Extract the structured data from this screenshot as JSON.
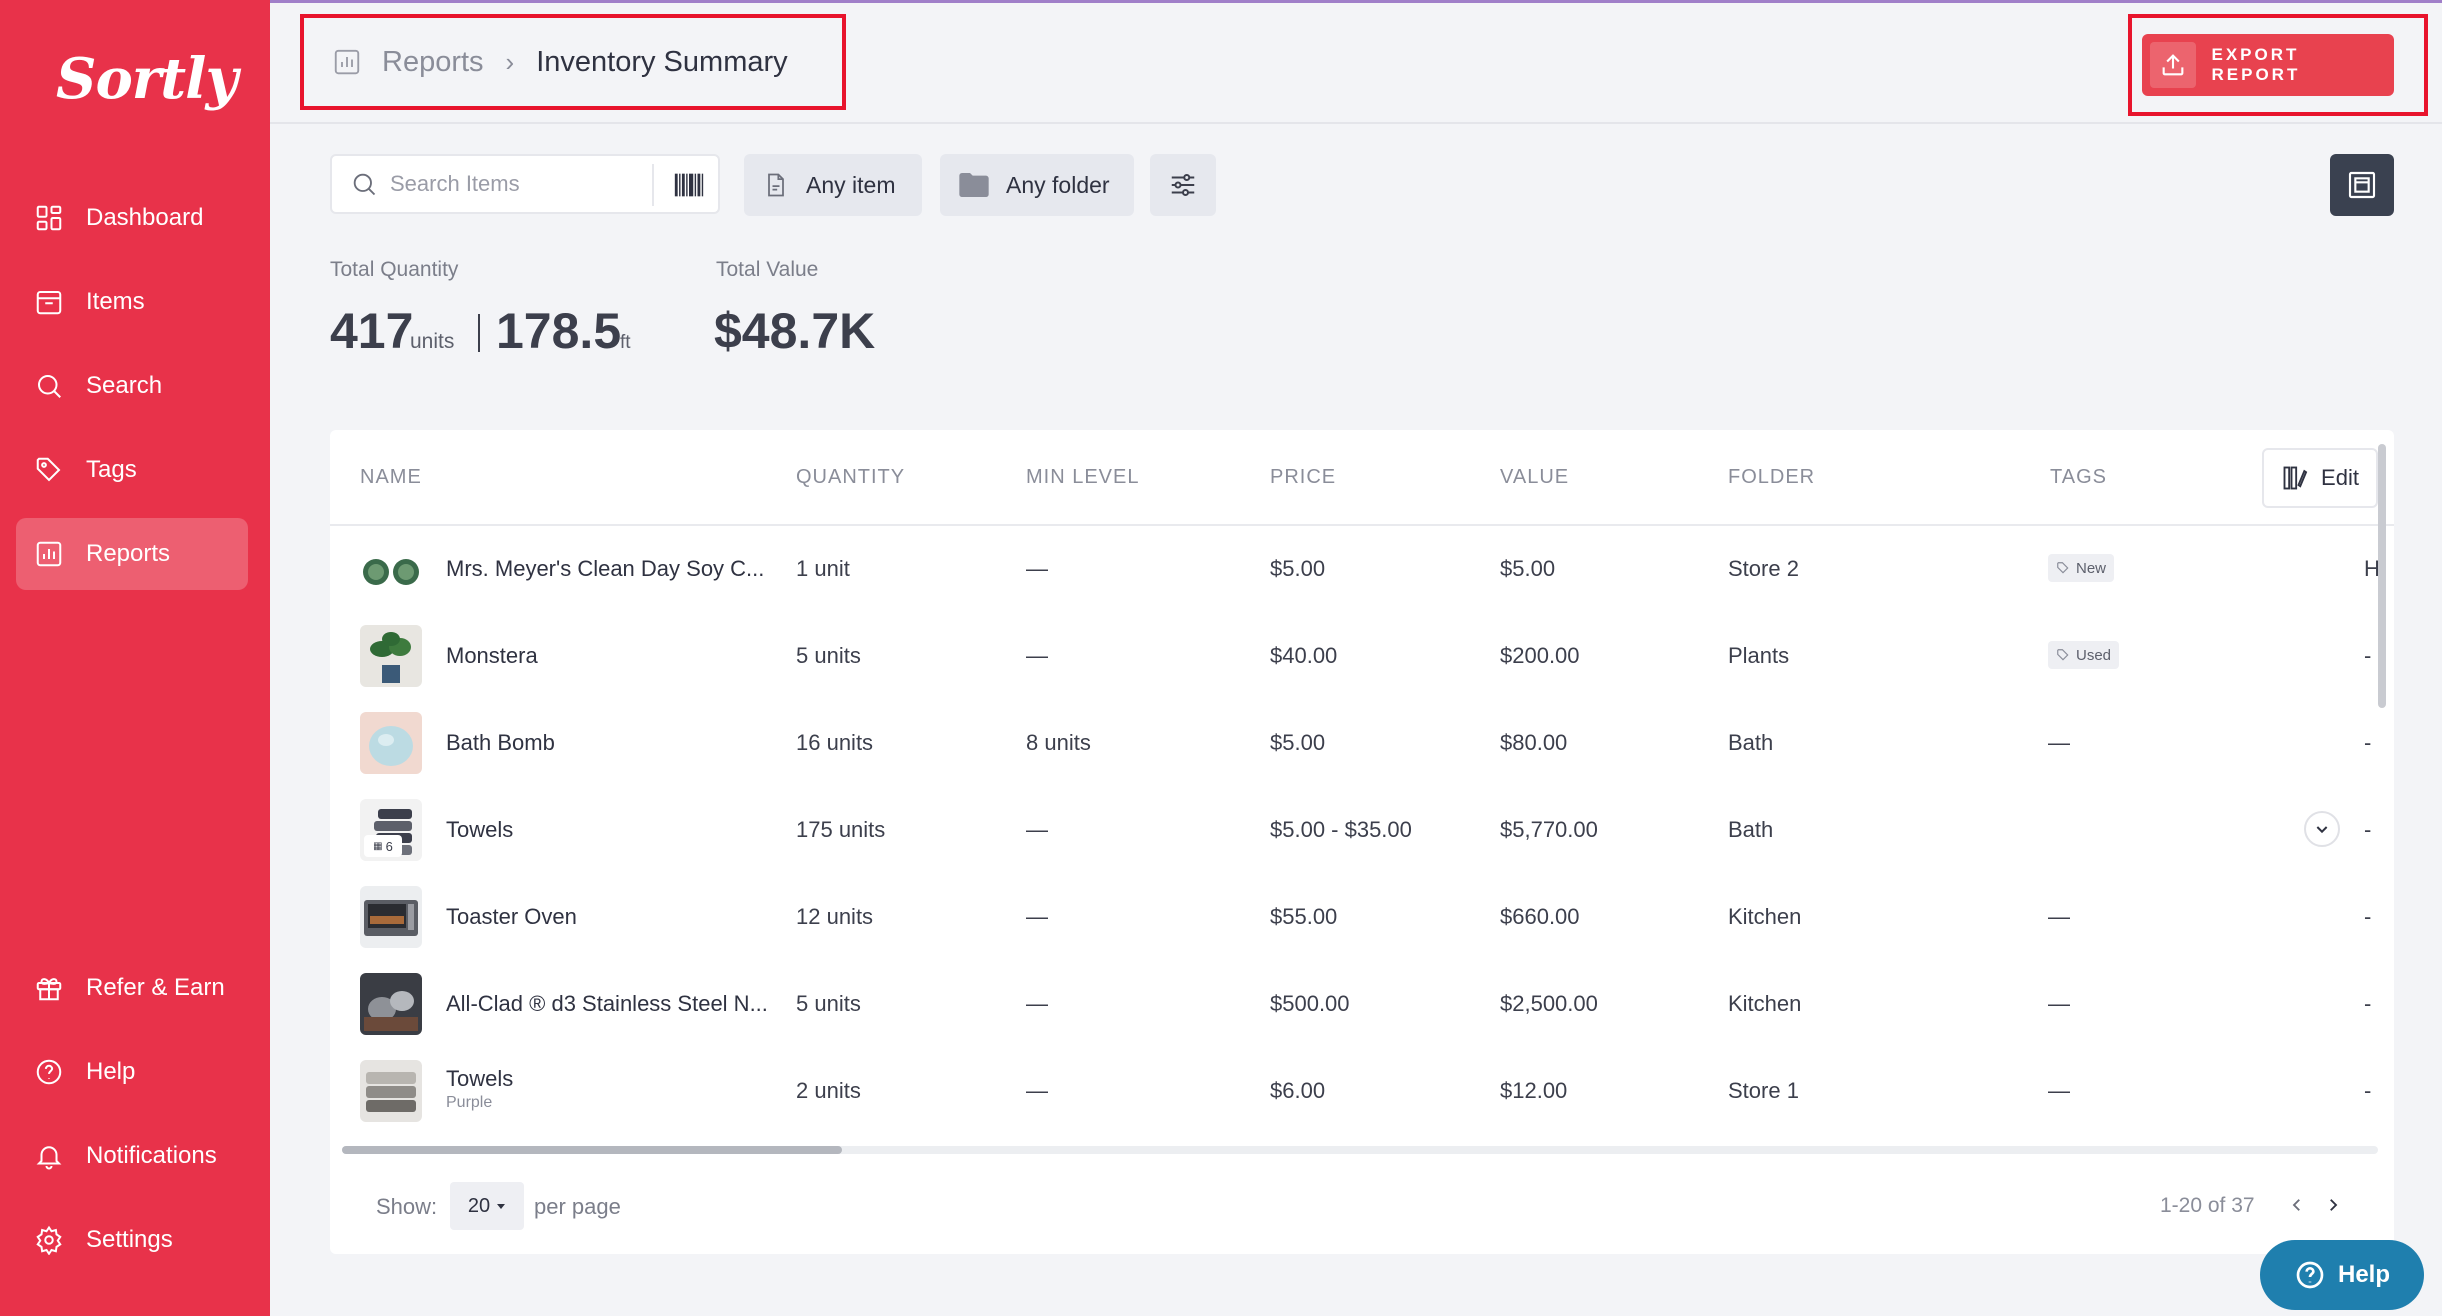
{
  "colors": {
    "sidebar": "#e8324a",
    "accent": "#e8424f",
    "highlight_box": "#e8142d",
    "help_fab": "#1f7fae"
  },
  "sidebar": {
    "logo": "Sortly",
    "items": [
      {
        "label": "Dashboard",
        "icon": "dashboard-icon"
      },
      {
        "label": "Items",
        "icon": "items-icon"
      },
      {
        "label": "Search",
        "icon": "search-icon"
      },
      {
        "label": "Tags",
        "icon": "tag-icon"
      },
      {
        "label": "Reports",
        "icon": "reports-icon",
        "active": true
      },
      {
        "label": "Refer & Earn",
        "icon": "gift-icon"
      },
      {
        "label": "Help",
        "icon": "help-icon"
      },
      {
        "label": "Notifications",
        "icon": "bell-icon"
      },
      {
        "label": "Settings",
        "icon": "gear-icon"
      }
    ]
  },
  "header": {
    "breadcrumb_root": "Reports",
    "breadcrumb_sep": "›",
    "breadcrumb_current": "Inventory Summary",
    "export_label": "EXPORT REPORT"
  },
  "filters": {
    "search_placeholder": "Search Items",
    "any_item": "Any item",
    "any_folder": "Any folder"
  },
  "totals": {
    "quantity_label": "Total Quantity",
    "quantity_value": "417",
    "quantity_unit": "units",
    "length_value": "178.5",
    "length_unit": "ft",
    "value_label": "Total Value",
    "value_value": "$48.7K"
  },
  "table": {
    "columns": [
      "NAME",
      "QUANTITY",
      "MIN LEVEL",
      "PRICE",
      "VALUE",
      "FOLDER",
      "TAGS"
    ],
    "edit_label": "Edit",
    "rows": [
      {
        "name": "Mrs. Meyer's Clean Day Soy C...",
        "sub": "",
        "quantity": "1 unit",
        "min_level": "—",
        "price": "$5.00",
        "value": "$5.00",
        "folder": "Store 2",
        "tag": "New",
        "edge": "H"
      },
      {
        "name": "Monstera",
        "sub": "",
        "quantity": "5 units",
        "min_level": "—",
        "price": "$40.00",
        "value": "$200.00",
        "folder": "Plants",
        "tag": "Used",
        "edge": "-"
      },
      {
        "name": "Bath Bomb",
        "sub": "",
        "quantity": "16 units",
        "min_level": "8 units",
        "price": "$5.00",
        "value": "$80.00",
        "folder": "Bath",
        "tag": "—",
        "edge": "-"
      },
      {
        "name": "Towels",
        "sub": "",
        "quantity": "175 units",
        "min_level": "—",
        "price": "$5.00 - $35.00",
        "value": "$5,770.00",
        "folder": "Bath",
        "tag": "",
        "edge": "-",
        "variants": "6"
      },
      {
        "name": "Toaster Oven",
        "sub": "",
        "quantity": "12 units",
        "min_level": "—",
        "price": "$55.00",
        "value": "$660.00",
        "folder": "Kitchen",
        "tag": "—",
        "edge": "-"
      },
      {
        "name": "All-Clad ® d3 Stainless Steel N...",
        "sub": "",
        "quantity": "5 units",
        "min_level": "—",
        "price": "$500.00",
        "value": "$2,500.00",
        "folder": "Kitchen",
        "tag": "—",
        "edge": "-"
      },
      {
        "name": "Towels",
        "sub": "Purple",
        "quantity": "2 units",
        "min_level": "—",
        "price": "$6.00",
        "value": "$12.00",
        "folder": "Store 1",
        "tag": "—",
        "edge": "-"
      }
    ]
  },
  "footer": {
    "show_label": "Show:",
    "page_size": "20",
    "per_page_label": "per page",
    "range": "1-20 of 37"
  },
  "help_fab_label": "Help"
}
